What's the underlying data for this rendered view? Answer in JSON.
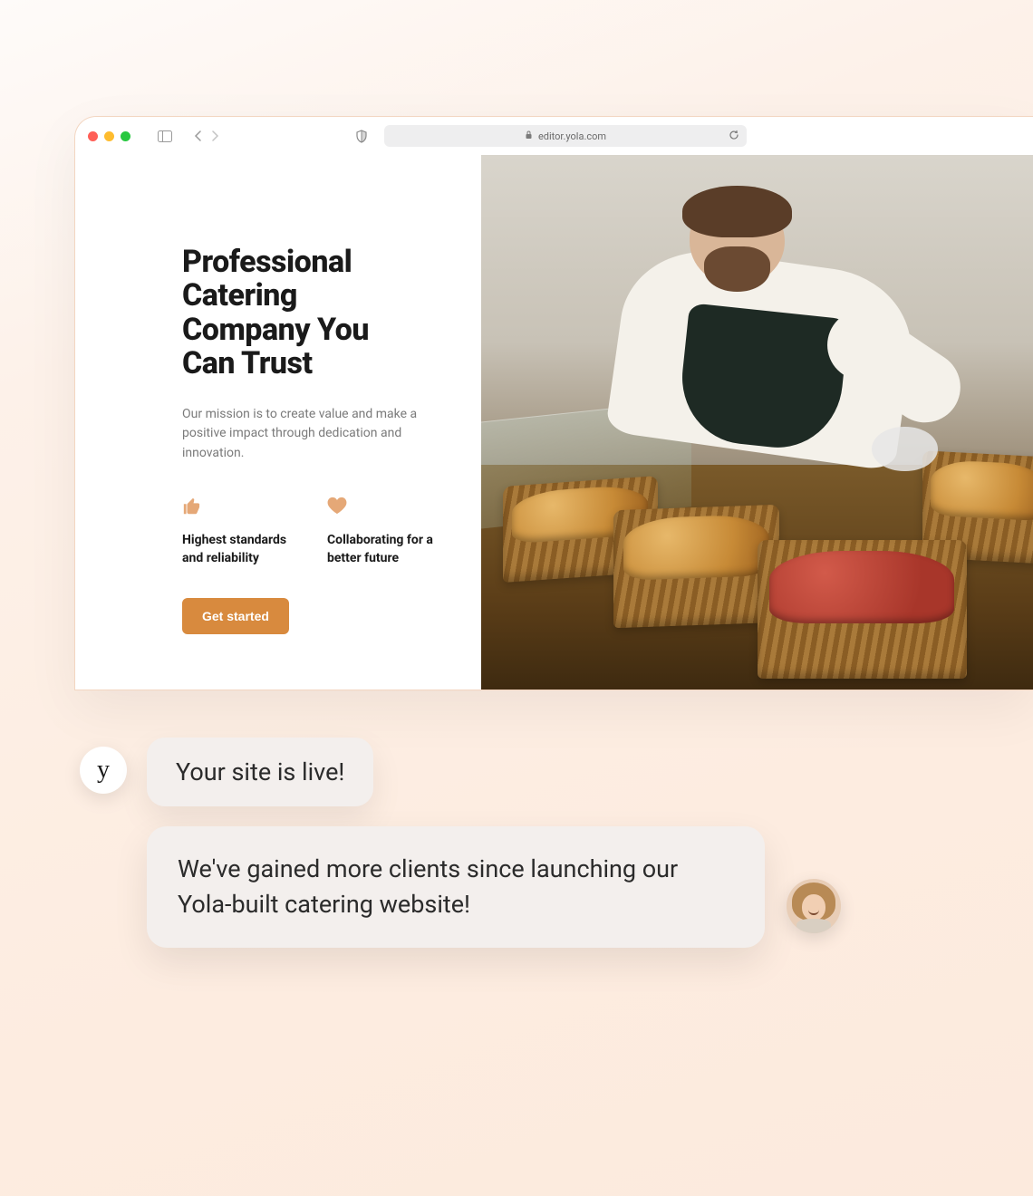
{
  "browser": {
    "url_host": "editor.yola.com"
  },
  "hero": {
    "title": "Professional Catering Company You Can Trust",
    "subtitle": "Our mission is to create value and make a positive impact through dedication and innovation.",
    "features": [
      {
        "icon": "thumbs-up-icon",
        "label": "Highest standards and reliability"
      },
      {
        "icon": "heart-icon",
        "label": "Collaborating for a better future"
      }
    ],
    "cta_label": "Get started"
  },
  "chat": {
    "brand_avatar_letter": "y",
    "message1": "Your site is live!",
    "message2": "We've gained more clients since launching our Yola-built catering website!"
  },
  "colors": {
    "accent": "#d88a3e",
    "icon_accent": "#e5a877"
  }
}
